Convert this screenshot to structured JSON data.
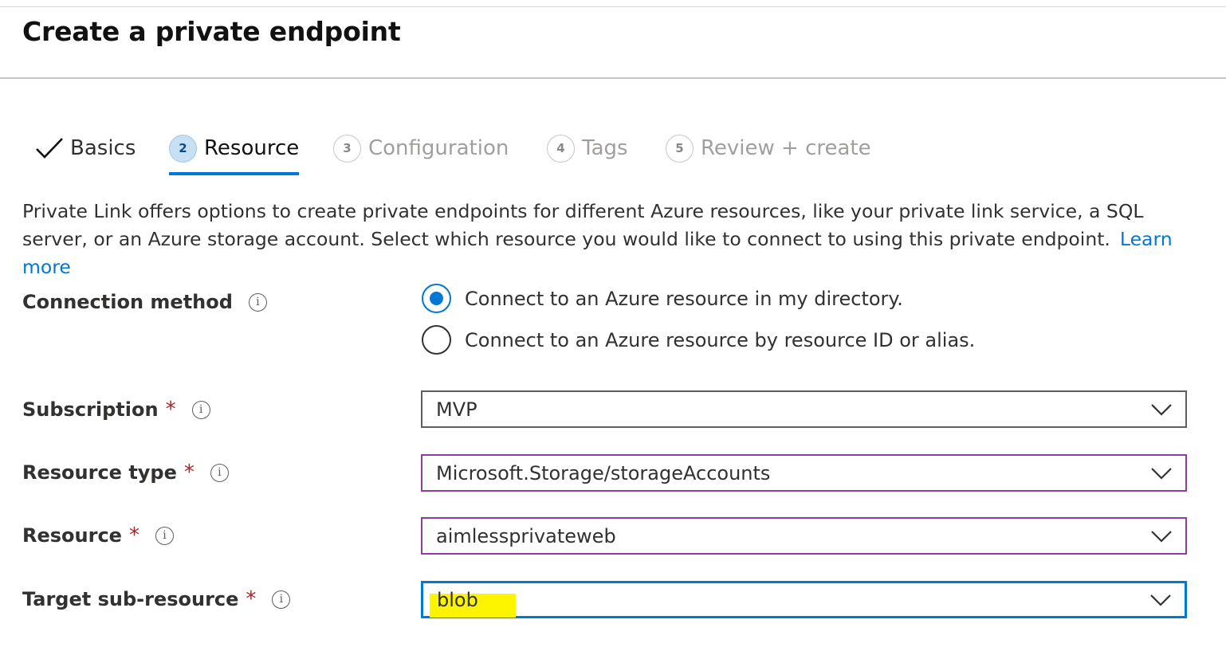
{
  "header": {
    "title": "Create a private endpoint"
  },
  "tabs": [
    {
      "label": "Basics",
      "step": "",
      "state": "done"
    },
    {
      "label": "Resource",
      "step": "2",
      "state": "active"
    },
    {
      "label": "Configuration",
      "step": "3",
      "state": "future"
    },
    {
      "label": "Tags",
      "step": "4",
      "state": "future"
    },
    {
      "label": "Review + create",
      "step": "5",
      "state": "future"
    }
  ],
  "description": {
    "text": "Private Link offers options to create private endpoints for different Azure resources, like your private link service, a SQL server, or an Azure storage account. Select which resource you would like to connect to using this private endpoint.",
    "link": "Learn more"
  },
  "connection_method": {
    "label": "Connection method",
    "info_icon": "i",
    "options": [
      {
        "label": "Connect to an Azure resource in my directory.",
        "selected": true
      },
      {
        "label": "Connect to an Azure resource by resource ID or alias.",
        "selected": false
      }
    ]
  },
  "fields": {
    "subscription": {
      "label": "Subscription",
      "required_mark": "*",
      "value": "MVP"
    },
    "resource_type": {
      "label": "Resource type",
      "required_mark": "*",
      "value": "Microsoft.Storage/storageAccounts"
    },
    "resource": {
      "label": "Resource",
      "required_mark": "*",
      "value": "aimlessprivateweb"
    },
    "target_sub_resource": {
      "label": "Target sub-resource",
      "required_mark": "*",
      "value": "blob"
    }
  },
  "colors": {
    "accent": "#0078d4",
    "required": "#a4262c",
    "touched_border": "#8a3f9b",
    "highlight": "#fdf500"
  }
}
